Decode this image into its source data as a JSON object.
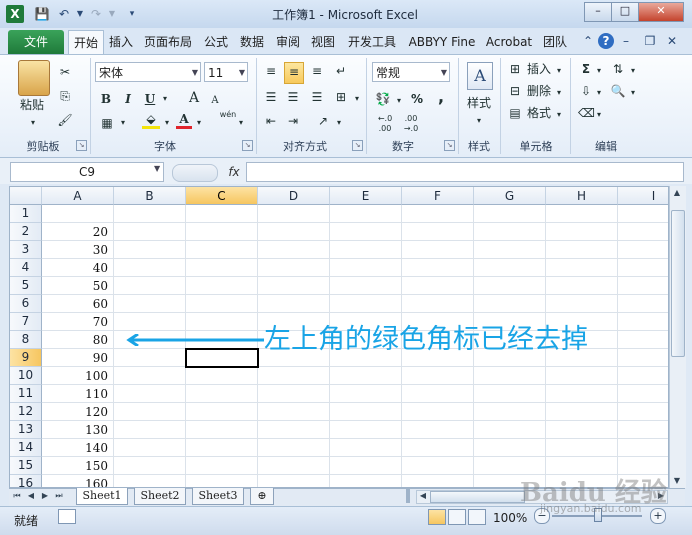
{
  "window": {
    "title": "工作簿1 - Microsoft Excel",
    "app_icon": "X",
    "controls": {
      "minimize": "–",
      "maximize": "□",
      "close": "✕"
    }
  },
  "quick_access": {
    "save_icon": "save-icon",
    "undo_icon": "undo-icon",
    "redo_icon": "redo-icon",
    "customize_icon": "dropdown-icon"
  },
  "tabs": [
    {
      "label": "文件"
    },
    {
      "label": "开始"
    },
    {
      "label": "插入"
    },
    {
      "label": "页面布局"
    },
    {
      "label": "公式"
    },
    {
      "label": "数据"
    },
    {
      "label": "审阅"
    },
    {
      "label": "视图"
    },
    {
      "label": "开发工具"
    },
    {
      "label": "ABBYY Fine"
    },
    {
      "label": "Acrobat"
    },
    {
      "label": "团队"
    }
  ],
  "ribbon": {
    "clipboard": {
      "label": "剪贴板",
      "paste": "粘贴"
    },
    "font": {
      "label": "字体",
      "font_name": "宋体",
      "font_size": "11",
      "bold": "B",
      "italic": "I",
      "underline": "U",
      "grow": "A",
      "shrink": "A",
      "font_color": "A",
      "phonetic": "wén"
    },
    "alignment": {
      "label": "对齐方式"
    },
    "number": {
      "label": "数字",
      "format": "常规",
      "percent": "%",
      "comma": ",",
      "inc_decimal": "←.0 .00",
      "dec_decimal": ".00 →.0"
    },
    "styles": {
      "label": "样式",
      "button": "样式"
    },
    "cells": {
      "label": "单元格",
      "insert": "插入",
      "delete": "删除",
      "format": "格式"
    },
    "editing": {
      "label": "编辑",
      "sum": "Σ"
    }
  },
  "formula_bar": {
    "name_box": "C9",
    "fx_label": "fx",
    "value": ""
  },
  "grid": {
    "columns": [
      "A",
      "B",
      "C",
      "D",
      "E",
      "F",
      "G",
      "H",
      "I"
    ],
    "rows": [
      "1",
      "2",
      "3",
      "4",
      "5",
      "6",
      "7",
      "8",
      "9",
      "10",
      "11",
      "12",
      "13",
      "14",
      "15",
      "16"
    ],
    "column_a_values": [
      "",
      "20",
      "30",
      "40",
      "50",
      "60",
      "70",
      "80",
      "90",
      "100",
      "110",
      "120",
      "130",
      "140",
      "150",
      "160"
    ],
    "active_cell": "C9",
    "active_column": "C",
    "active_row": "9"
  },
  "annotation": {
    "text": "左上角的绿色角标已经去掉",
    "color": "#19a4e6"
  },
  "sheets": [
    {
      "label": "Sheet1",
      "active": true
    },
    {
      "label": "Sheet2"
    },
    {
      "label": "Sheet3"
    }
  ],
  "status": {
    "ready": "就绪",
    "zoom": "100%"
  },
  "watermark": {
    "text": "Baidu 经验",
    "sub": "jingyan.baidu.com"
  }
}
